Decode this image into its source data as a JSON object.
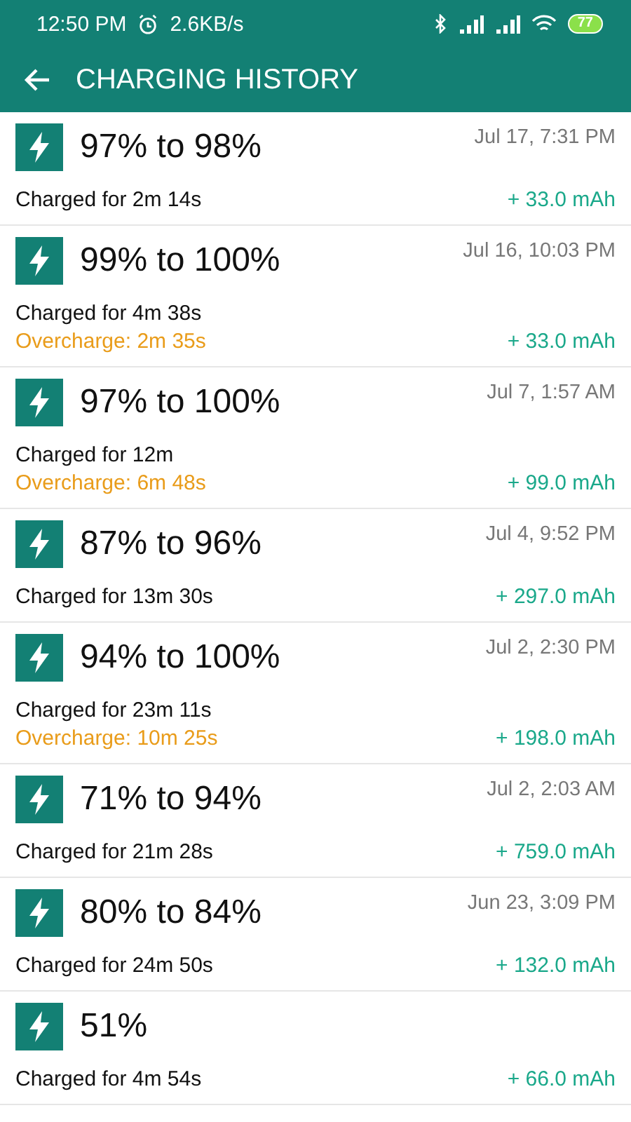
{
  "status_bar": {
    "time": "12:50 PM",
    "speed": "2.6KB/s",
    "battery": "77"
  },
  "toolbar": {
    "title": "CHARGING HISTORY"
  },
  "sessions": [
    {
      "range": "97% to 98%",
      "date": "Jul 17, 7:31 PM",
      "duration": "Charged for 2m 14s",
      "amount": "+ 33.0 mAh"
    },
    {
      "range": "99% to 100%",
      "date": "Jul 16, 10:03 PM",
      "duration": "Charged for 4m 38s",
      "overcharge": "Overcharge: 2m 35s",
      "amount": "+ 33.0 mAh"
    },
    {
      "range": "97% to 100%",
      "date": "Jul 7, 1:57 AM",
      "duration": "Charged for 12m",
      "overcharge": "Overcharge: 6m 48s",
      "amount": "+ 99.0 mAh"
    },
    {
      "range": "87% to 96%",
      "date": "Jul 4, 9:52 PM",
      "duration": "Charged for 13m 30s",
      "amount": "+ 297.0 mAh"
    },
    {
      "range": "94% to 100%",
      "date": "Jul 2, 2:30 PM",
      "duration": "Charged for 23m 11s",
      "overcharge": "Overcharge: 10m 25s",
      "amount": "+ 198.0 mAh"
    },
    {
      "range": "71% to 94%",
      "date": "Jul 2, 2:03 AM",
      "duration": "Charged for 21m 28s",
      "amount": "+ 759.0 mAh"
    },
    {
      "range": "80% to 84%",
      "date": "Jun 23, 3:09 PM",
      "duration": "Charged for 24m 50s",
      "amount": "+ 132.0 mAh"
    },
    {
      "range": "51%",
      "duration": "Charged for 4m 54s",
      "amount": "+ 66.0 mAh"
    }
  ]
}
